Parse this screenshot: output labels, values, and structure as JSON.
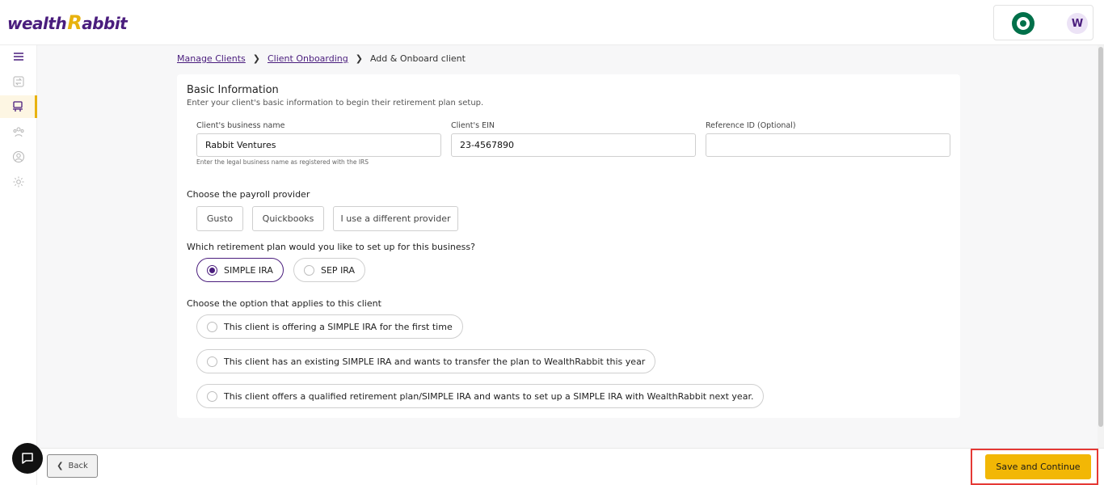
{
  "header": {
    "logo_prefix": "wealth",
    "logo_r": "R",
    "logo_suffix": "abbit",
    "brand_icon": "starbucks-logo-icon",
    "avatar_initial": "W"
  },
  "sidebar": {
    "items": [
      {
        "icon": "menu-icon"
      },
      {
        "icon": "transfer-icon"
      },
      {
        "icon": "clients-desk-icon",
        "active": true
      },
      {
        "icon": "team-icon"
      },
      {
        "icon": "user-profile-icon"
      },
      {
        "icon": "settings-gear-icon"
      }
    ]
  },
  "breadcrumb": {
    "items": [
      "Manage Clients",
      "Client Onboarding"
    ],
    "current": "Add & Onboard client"
  },
  "basic_info": {
    "title": "Basic Information",
    "subtitle": "Enter your client's basic information to begin their retirement plan setup.",
    "business_name_label": "Client's business name",
    "business_name_value": "Rabbit Ventures",
    "business_name_help": "Enter the legal business name as registered with the IRS",
    "ein_label": "Client's EIN",
    "ein_value": "23-4567890",
    "reference_label": "Reference ID (Optional)",
    "reference_value": ""
  },
  "payroll": {
    "question": "Choose the payroll provider",
    "options": [
      "Gusto",
      "Quickbooks",
      "I use a different provider"
    ]
  },
  "plan": {
    "question": "Which retirement plan would you like to set up for this business?",
    "options": [
      "SIMPLE IRA",
      "SEP IRA"
    ],
    "selected": "SIMPLE IRA"
  },
  "client_option": {
    "question": "Choose the option that applies to this client",
    "options": [
      "This client is offering a SIMPLE IRA for the first time",
      "This client has an existing SIMPLE IRA and wants to transfer the plan to WealthRabbit this year",
      "This client offers a qualified retirement plan/SIMPLE IRA and wants to set up a SIMPLE IRA with WealthRabbit next year."
    ]
  },
  "footer": {
    "back_label": "Back",
    "save_label": "Save and Continue"
  },
  "colors": {
    "brand_purple": "#4a1d7d",
    "accent_yellow": "#f2b705",
    "highlight_red": "#e53935"
  }
}
